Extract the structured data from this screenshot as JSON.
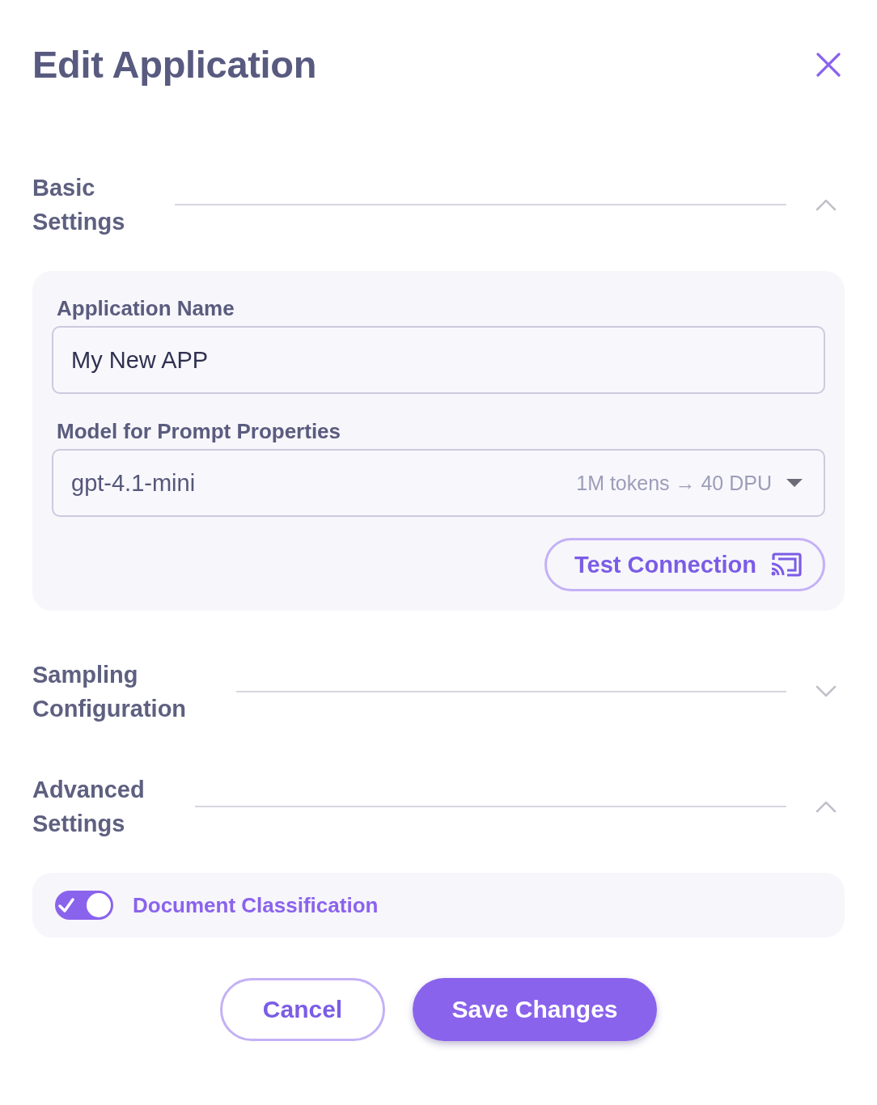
{
  "dialog": {
    "title": "Edit Application"
  },
  "sections": [
    {
      "title": "Basic Settings",
      "expanded": true,
      "fields": [
        {
          "kind": "text",
          "label": "Application Name",
          "value": "My New APP"
        },
        {
          "kind": "select",
          "label": "Model for Prompt Properties",
          "value": "gpt-4.1-mini",
          "hint": "1M tokens → 40 DPU"
        }
      ],
      "action": "Test Connection"
    },
    {
      "title": "Sampling Configuration",
      "expanded": false
    },
    {
      "title": "Advanced Settings",
      "expanded": true,
      "toggles": [
        {
          "label": "Document Classification",
          "on": true
        }
      ]
    }
  ],
  "buttons": [
    {
      "kind": "secondary",
      "label": "Cancel"
    },
    {
      "kind": "primary",
      "label": "Save Changes"
    }
  ]
}
